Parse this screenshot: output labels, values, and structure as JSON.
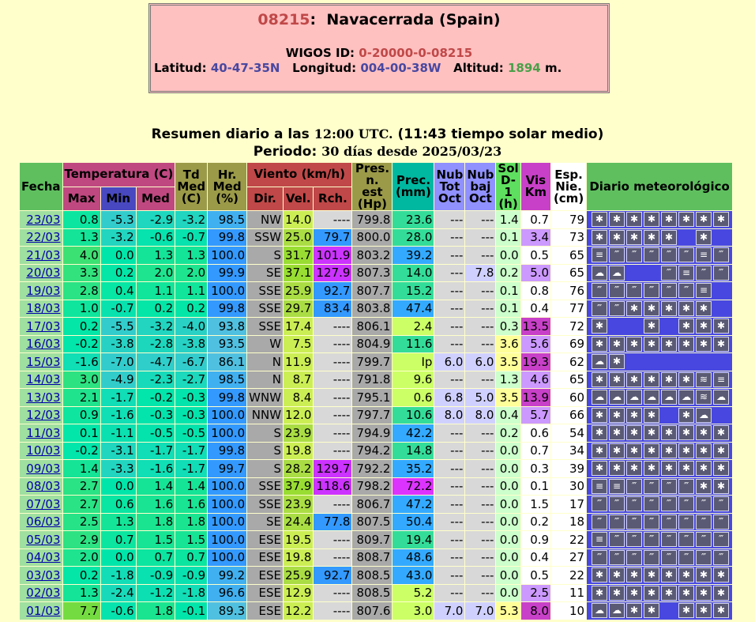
{
  "station": {
    "code": "08215",
    "name": "Navacerrada (Spain)",
    "wigos_label": "WIGOS ID:",
    "wigos_id": "0-20000-0-08215",
    "lat_label": "Latitud:",
    "lat": "40-47-35N",
    "lon_label": "Longitud:",
    "lon": "004-00-38W",
    "alt_label": "Altitud:",
    "alt": "1894",
    "alt_unit": "m."
  },
  "summary": {
    "line1_a": "Resumen diario a las",
    "line1_time": "12:00 UTC.",
    "line1_b": "(11:43 tiempo solar medio)",
    "line2_a": "Periodo:",
    "line2_b": "30 días desde 2025/03/23"
  },
  "headers": {
    "fecha": "Fecha",
    "temp": "Temperatura (C)",
    "max": "Max",
    "min": "Min",
    "med": "Med",
    "td": "Td Med (C)",
    "hr": "Hr. Med (%)",
    "viento": "Viento (km/h)",
    "dir": "Dir.",
    "vel": "Vel.",
    "rch": "Rch.",
    "pres": "Pres. n. est (Hp)",
    "prec": "Prec. (mm)",
    "nubtot": "Nub Tot Oct",
    "nubbaj": "Nub baj Oct",
    "sol": "Sol D-1 (h)",
    "vis": "Vis Km",
    "esp": "Esp. Nie. (cm)",
    "diario": "Diario meteorológico"
  },
  "colors": {
    "background": "#ffffcc",
    "header_green": "#5fbf5f",
    "rch_magenta": "#cc33ff",
    "prec_high": "#dd33ff",
    "vis_high": "#c840c8"
  },
  "rows": [
    {
      "date": "23/03",
      "max": "0.8",
      "min": "-5.3",
      "med": "-2.9",
      "td": "-3.2",
      "hr": "98.5",
      "dir": "NW",
      "vel": "14.0",
      "rch": "----",
      "pres": "799.8",
      "prec": "23.6",
      "nubtot": "---",
      "nubbaj": "---",
      "sol": "1.4",
      "vis": "0.7",
      "esp": "79",
      "icons": [
        "snow-icon",
        "snow-icon",
        "snow-icon",
        "snow-icon",
        "snow-icon",
        "snow-icon",
        "snow-icon",
        "snow-icon"
      ]
    },
    {
      "date": "22/03",
      "max": "1.3",
      "min": "-3.2",
      "med": "-0.6",
      "td": "-0.7",
      "hr": "99.8",
      "dir": "SSW",
      "vel": "25.0",
      "rch": "79.7",
      "pres": "800.0",
      "prec": "28.0",
      "nubtot": "---",
      "nubbaj": "---",
      "sol": "0.1",
      "vis": "3.4",
      "esp": "73",
      "icons": [
        "snow-icon",
        "snow-icon",
        "snow-icon",
        "snow-icon",
        "snow-icon",
        "",
        "snow-icon",
        ""
      ]
    },
    {
      "date": "21/03",
      "max": "4.0",
      "min": "0.0",
      "med": "1.3",
      "td": "1.3",
      "hr": "100.0",
      "dir": "S",
      "vel": "31.7",
      "rch": "101.9",
      "pres": "803.2",
      "prec": "39.2",
      "nubtot": "---",
      "nubbaj": "---",
      "sol": "0.0",
      "vis": "0.5",
      "esp": "65",
      "icons": [
        "fog-icon",
        "rain-icon",
        "rain-icon",
        "rain-icon",
        "rain-icon",
        "rain-icon",
        "fog-icon",
        "rain-icon"
      ]
    },
    {
      "date": "20/03",
      "max": "3.3",
      "min": "0.2",
      "med": "2.0",
      "td": "2.0",
      "hr": "99.9",
      "dir": "SE",
      "vel": "37.1",
      "rch": "127.9",
      "pres": "807.3",
      "prec": "14.0",
      "nubtot": "---",
      "nubbaj": "7.8",
      "sol": "0.2",
      "vis": "5.0",
      "esp": "65",
      "icons": [
        "cloud-icon",
        "cloud-icon",
        "",
        "",
        "rain-icon",
        "fog-icon",
        "rain-icon",
        "rain-icon"
      ]
    },
    {
      "date": "19/03",
      "max": "2.8",
      "min": "0.4",
      "med": "1.1",
      "td": "1.1",
      "hr": "100.0",
      "dir": "SSE",
      "vel": "25.9",
      "rch": "92.7",
      "pres": "807.7",
      "prec": "15.2",
      "nubtot": "---",
      "nubbaj": "---",
      "sol": "0.1",
      "vis": "0.8",
      "esp": "76",
      "icons": [
        "rain-icon",
        "rain-icon",
        "rain-icon",
        "rain-icon",
        "rain-icon",
        "rain-icon",
        "fog-icon",
        ""
      ]
    },
    {
      "date": "18/03",
      "max": "1.0",
      "min": "-0.7",
      "med": "0.2",
      "td": "0.2",
      "hr": "99.8",
      "dir": "SSE",
      "vel": "29.7",
      "rch": "83.4",
      "pres": "803.8",
      "prec": "47.4",
      "nubtot": "---",
      "nubbaj": "---",
      "sol": "0.1",
      "vis": "0.4",
      "esp": "77",
      "icons": [
        "rain-icon",
        "rain-icon",
        "snow-icon",
        "snow-icon",
        "snow-icon",
        "snow-icon",
        "snow-icon",
        ""
      ]
    },
    {
      "date": "17/03",
      "max": "0.2",
      "min": "-5.5",
      "med": "-3.2",
      "td": "-4.0",
      "hr": "93.8",
      "dir": "SSE",
      "vel": "17.4",
      "rch": "----",
      "pres": "806.1",
      "prec": "2.4",
      "nubtot": "---",
      "nubbaj": "---",
      "sol": "0.3",
      "vis": "13.5",
      "esp": "72",
      "icons": [
        "snow-icon",
        "",
        "",
        "snow-icon",
        "",
        "snow-icon",
        "snow-icon",
        "snow-icon"
      ]
    },
    {
      "date": "16/03",
      "max": "-0.2",
      "min": "-3.8",
      "med": "-2.8",
      "td": "-3.8",
      "hr": "93.5",
      "dir": "W",
      "vel": "7.5",
      "rch": "----",
      "pres": "804.9",
      "prec": "11.6",
      "nubtot": "---",
      "nubbaj": "---",
      "sol": "3.6",
      "vis": "5.6",
      "esp": "69",
      "icons": [
        "snow-icon",
        "snow-icon",
        "snow-icon",
        "snow-icon",
        "snow-icon",
        "snow-icon",
        "snow-icon",
        "snow-icon"
      ]
    },
    {
      "date": "15/03",
      "max": "-1.6",
      "min": "-7.0",
      "med": "-4.7",
      "td": "-6.7",
      "hr": "86.1",
      "dir": "N",
      "vel": "11.9",
      "rch": "----",
      "pres": "799.7",
      "prec": "Ip",
      "nubtot": "6.0",
      "nubbaj": "6.0",
      "sol": "3.5",
      "vis": "19.3",
      "esp": "62",
      "icons": [
        "cloud-icon",
        "snow-icon",
        "",
        "",
        "",
        "",
        "",
        ""
      ]
    },
    {
      "date": "14/03",
      "max": "3.0",
      "min": "-4.9",
      "med": "-2.3",
      "td": "-2.7",
      "hr": "98.5",
      "dir": "N",
      "vel": "8.7",
      "rch": "----",
      "pres": "791.8",
      "prec": "9.6",
      "nubtot": "---",
      "nubbaj": "---",
      "sol": "1.3",
      "vis": "4.6",
      "esp": "65",
      "icons": [
        "snow-icon",
        "snow-icon",
        "snow-icon",
        "snow-icon",
        "snow-icon",
        "snow-icon",
        "storm-icon",
        "fog-icon"
      ]
    },
    {
      "date": "13/03",
      "max": "2.1",
      "min": "-1.7",
      "med": "-0.2",
      "td": "-0.3",
      "hr": "99.8",
      "dir": "WNW",
      "vel": "8.4",
      "rch": "----",
      "pres": "795.1",
      "prec": "0.6",
      "nubtot": "6.8",
      "nubbaj": "5.0",
      "sol": "3.5",
      "vis": "13.9",
      "esp": "60",
      "icons": [
        "cloud-icon",
        "cloud-icon",
        "cloud-icon",
        "cloud-icon",
        "cloud-icon",
        "cloud-icon",
        "storm-icon",
        "cloud-icon"
      ]
    },
    {
      "date": "12/03",
      "max": "0.9",
      "min": "-1.6",
      "med": "-0.3",
      "td": "-0.3",
      "hr": "100.0",
      "dir": "NNW",
      "vel": "12.0",
      "rch": "----",
      "pres": "797.7",
      "prec": "10.6",
      "nubtot": "8.0",
      "nubbaj": "8.0",
      "sol": "0.4",
      "vis": "5.7",
      "esp": "66",
      "icons": [
        "snow-icon",
        "snow-icon",
        "snow-icon",
        "snow-icon",
        "",
        "snow-icon",
        "cloud-icon",
        ""
      ]
    },
    {
      "date": "11/03",
      "max": "0.1",
      "min": "-1.1",
      "med": "-0.5",
      "td": "-0.5",
      "hr": "100.0",
      "dir": "S",
      "vel": "23.9",
      "rch": "----",
      "pres": "794.9",
      "prec": "42.2",
      "nubtot": "---",
      "nubbaj": "---",
      "sol": "0.2",
      "vis": "0.6",
      "esp": "54",
      "icons": [
        "snow-icon",
        "snow-icon",
        "snow-icon",
        "snow-icon",
        "snow-icon",
        "snow-icon",
        "snow-icon",
        "snow-icon"
      ]
    },
    {
      "date": "10/03",
      "max": "-0.2",
      "min": "-3.1",
      "med": "-1.7",
      "td": "-1.7",
      "hr": "99.8",
      "dir": "S",
      "vel": "19.8",
      "rch": "----",
      "pres": "794.2",
      "prec": "14.8",
      "nubtot": "---",
      "nubbaj": "---",
      "sol": "0.0",
      "vis": "0.7",
      "esp": "34",
      "icons": [
        "snow-icon",
        "snow-icon",
        "snow-icon",
        "snow-icon",
        "snow-icon",
        "snow-icon",
        "snow-icon",
        "snow-icon"
      ]
    },
    {
      "date": "09/03",
      "max": "1.4",
      "min": "-3.3",
      "med": "-1.6",
      "td": "-1.7",
      "hr": "99.7",
      "dir": "S",
      "vel": "28.2",
      "rch": "129.7",
      "pres": "792.2",
      "prec": "35.2",
      "nubtot": "---",
      "nubbaj": "---",
      "sol": "0.0",
      "vis": "0.3",
      "esp": "39",
      "icons": [
        "snow-icon",
        "snow-icon",
        "snow-icon",
        "snow-icon",
        "snow-icon",
        "snow-icon",
        "snow-icon",
        "snow-icon"
      ]
    },
    {
      "date": "08/03",
      "max": "2.7",
      "min": "0.0",
      "med": "1.4",
      "td": "1.4",
      "hr": "100.0",
      "dir": "SSE",
      "vel": "37.9",
      "rch": "118.6",
      "pres": "798.2",
      "prec": "72.2",
      "nubtot": "---",
      "nubbaj": "---",
      "sol": "0.0",
      "vis": "0.1",
      "esp": "30",
      "icons": [
        "fog-icon",
        "fog-icon",
        "rain-icon",
        "rain-icon",
        "rain-icon",
        "rain-icon",
        "snow-icon",
        "snow-icon"
      ]
    },
    {
      "date": "07/03",
      "max": "2.7",
      "min": "0.6",
      "med": "1.6",
      "td": "1.6",
      "hr": "100.0",
      "dir": "SSE",
      "vel": "23.9",
      "rch": "----",
      "pres": "806.7",
      "prec": "47.2",
      "nubtot": "---",
      "nubbaj": "---",
      "sol": "0.0",
      "vis": "1.5",
      "esp": "17",
      "icons": [
        "rain-icon",
        "rain-icon",
        "rain-icon",
        "rain-icon",
        "rain-icon",
        "rain-icon",
        "rain-icon",
        "rain-icon"
      ]
    },
    {
      "date": "06/03",
      "max": "2.5",
      "min": "1.3",
      "med": "1.8",
      "td": "1.8",
      "hr": "100.0",
      "dir": "SE",
      "vel": "24.4",
      "rch": "77.8",
      "pres": "807.5",
      "prec": "50.4",
      "nubtot": "---",
      "nubbaj": "---",
      "sol": "0.0",
      "vis": "0.2",
      "esp": "18",
      "icons": [
        "rain-icon",
        "rain-icon",
        "rain-icon",
        "rain-icon",
        "rain-icon",
        "rain-icon",
        "rain-icon",
        "rain-icon"
      ]
    },
    {
      "date": "05/03",
      "max": "2.9",
      "min": "0.7",
      "med": "1.5",
      "td": "1.5",
      "hr": "100.0",
      "dir": "ESE",
      "vel": "19.5",
      "rch": "----",
      "pres": "809.7",
      "prec": "19.4",
      "nubtot": "---",
      "nubbaj": "---",
      "sol": "0.0",
      "vis": "0.9",
      "esp": "22",
      "icons": [
        "fog-icon",
        "rain-icon",
        "rain-icon",
        "rain-icon",
        "rain-icon",
        "rain-icon",
        "rain-icon",
        "rain-icon"
      ]
    },
    {
      "date": "04/03",
      "max": "2.0",
      "min": "0.0",
      "med": "0.7",
      "td": "0.7",
      "hr": "100.0",
      "dir": "ESE",
      "vel": "19.8",
      "rch": "----",
      "pres": "808.7",
      "prec": "48.6",
      "nubtot": "---",
      "nubbaj": "---",
      "sol": "0.0",
      "vis": "0.4",
      "esp": "27",
      "icons": [
        "rain-icon",
        "rain-icon",
        "rain-icon",
        "rain-icon",
        "rain-icon",
        "rain-icon",
        "rain-icon",
        "rain-icon"
      ]
    },
    {
      "date": "03/03",
      "max": "0.2",
      "min": "-1.8",
      "med": "-0.9",
      "td": "-0.9",
      "hr": "99.2",
      "dir": "ESE",
      "vel": "25.9",
      "rch": "92.7",
      "pres": "808.5",
      "prec": "43.0",
      "nubtot": "---",
      "nubbaj": "---",
      "sol": "0.0",
      "vis": "0.5",
      "esp": "22",
      "icons": [
        "snow-icon",
        "snow-icon",
        "snow-icon",
        "snow-icon",
        "snow-icon",
        "snow-icon",
        "snow-icon",
        "snow-icon"
      ]
    },
    {
      "date": "02/03",
      "max": "1.3",
      "min": "-2.4",
      "med": "-1.2",
      "td": "-1.8",
      "hr": "96.6",
      "dir": "ESE",
      "vel": "12.9",
      "rch": "----",
      "pres": "808.5",
      "prec": "5.2",
      "nubtot": "---",
      "nubbaj": "---",
      "sol": "0.0",
      "vis": "2.5",
      "esp": "11",
      "icons": [
        "snow-icon",
        "snow-icon",
        "snow-icon",
        "snow-icon",
        "snow-icon",
        "snow-icon",
        "snow-icon",
        "snow-icon"
      ]
    },
    {
      "date": "01/03",
      "max": "7.7",
      "min": "-0.6",
      "med": "1.8",
      "td": "-0.1",
      "hr": "89.3",
      "dir": "ESE",
      "vel": "12.2",
      "rch": "----",
      "pres": "807.6",
      "prec": "3.0",
      "nubtot": "7.0",
      "nubbaj": "7.0",
      "sol": "5.3",
      "vis": "8.0",
      "esp": "10",
      "icons": [
        "cloud-icon",
        "cloud-icon",
        "snow-icon",
        "snow-icon",
        "",
        "snow-icon",
        "snow-icon",
        "snow-icon"
      ]
    }
  ]
}
